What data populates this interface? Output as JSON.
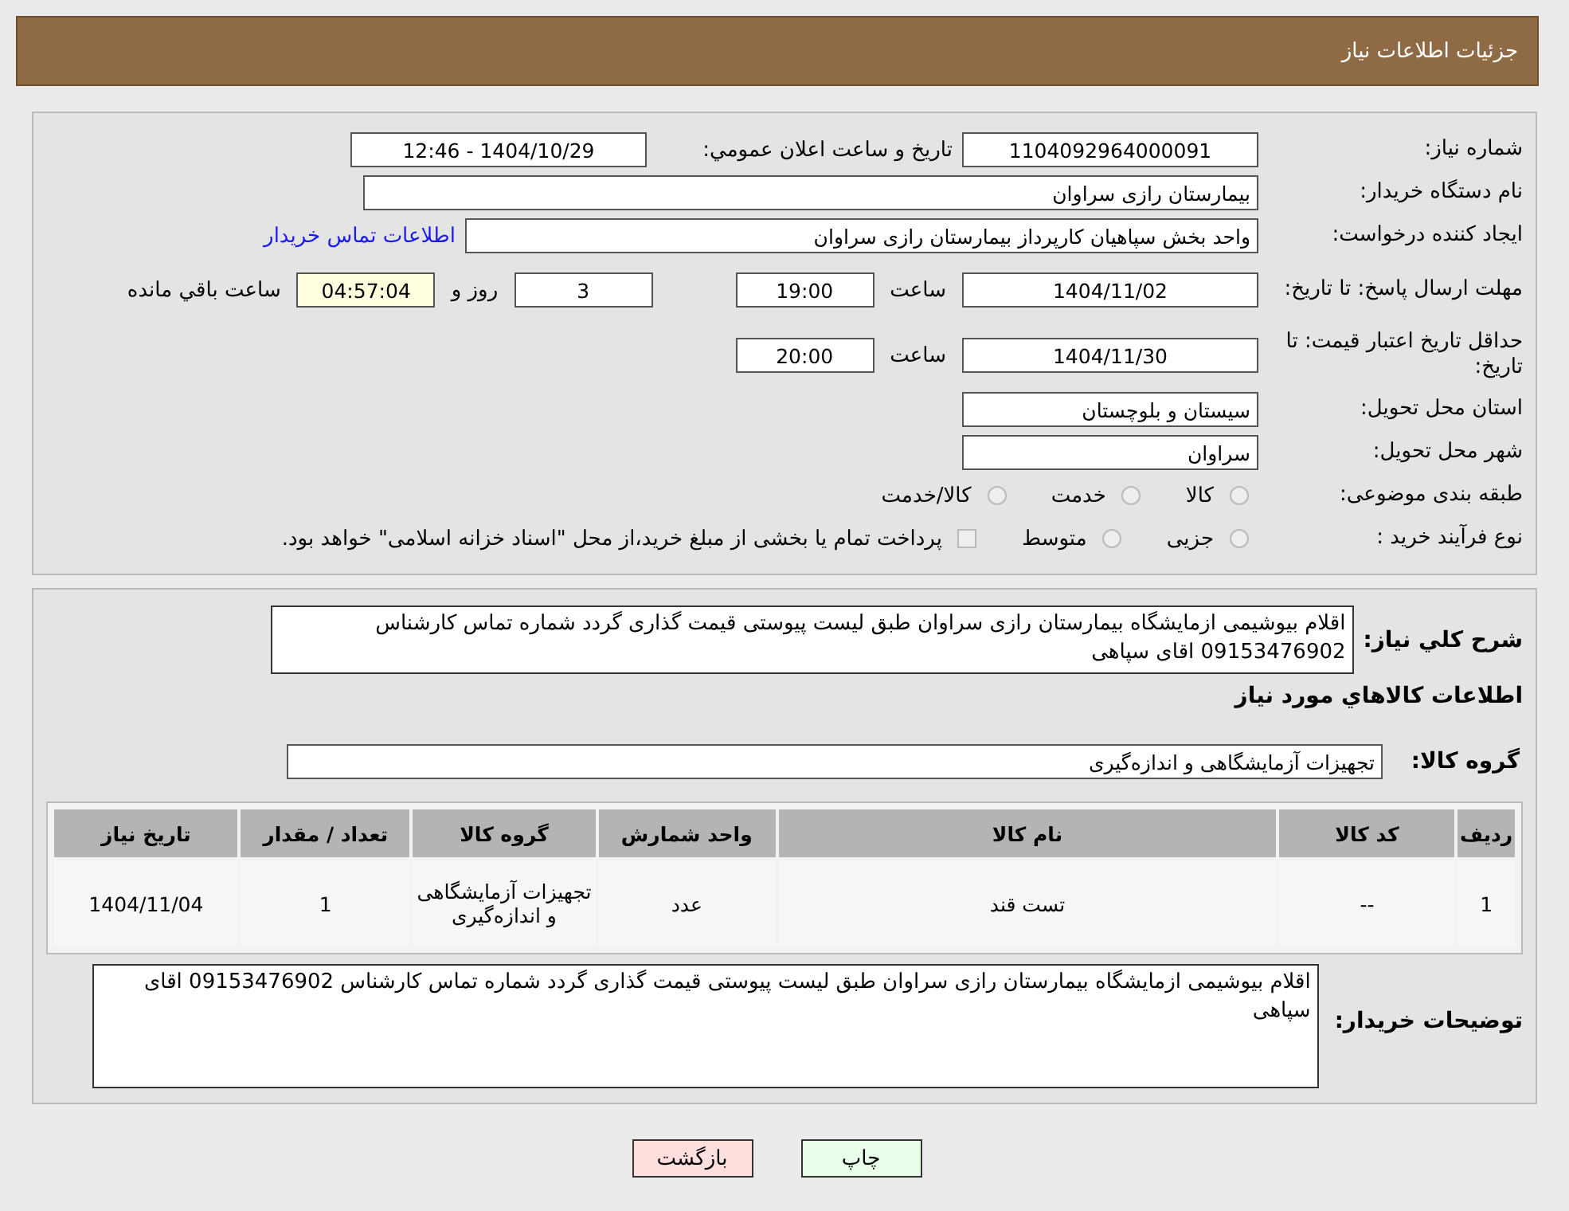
{
  "header": {
    "title": "جزئیات اطلاعات نیاز"
  },
  "need_number": {
    "label": "شماره نیاز:",
    "value": "1104092964000091"
  },
  "announce": {
    "label": "تاریخ و ساعت اعلان عمومي:",
    "value": "1404/10/29 - 12:46"
  },
  "buyer_org": {
    "label": "نام دستگاه خریدار:",
    "value": "بیمارستان رازی سراوان"
  },
  "requester": {
    "label": "ایجاد کننده درخواست:",
    "value": "واحد بخش  سپاهیان کارپرداز بیمارستان رازی سراوان",
    "link": "اطلاعات تماس خریدار"
  },
  "reply_deadline": {
    "label": "مهلت ارسال پاسخ: تا تاریخ:",
    "date": "1404/11/02",
    "time_label": "ساعت",
    "time": "19:00",
    "days": "3",
    "days_label": "روز و",
    "remaining": "04:57:04",
    "remaining_label": "ساعت باقي مانده"
  },
  "price_validity": {
    "label": "حداقل تاریخ اعتبار قیمت: تا تاریخ:",
    "date": "1404/11/30",
    "time_label": "ساعت",
    "time": "20:00"
  },
  "province": {
    "label": "استان محل تحویل:",
    "value": "سیستان و بلوچستان"
  },
  "city": {
    "label": "شهر محل تحویل:",
    "value": "سراوان"
  },
  "category": {
    "label": "طبقه بندی موضوعی:",
    "options": [
      {
        "label": "کالا",
        "selected": false
      },
      {
        "label": "خدمت",
        "selected": false
      },
      {
        "label": "کالا/خدمت",
        "selected": false
      }
    ]
  },
  "purchase_type": {
    "label": "نوع فرآیند خرید :",
    "options": [
      {
        "kind": "radio",
        "label": "جزیی",
        "selected": false
      },
      {
        "kind": "radio",
        "label": "متوسط",
        "selected": false
      },
      {
        "kind": "checkbox",
        "label": "پرداخت تمام یا بخشی از مبلغ خرید،از محل \"اسناد خزانه اسلامی\" خواهد بود.",
        "checked": false
      }
    ]
  },
  "description": {
    "label": "شرح کلي نیاز:",
    "value": "اقلام بیوشیمی ازمایشگاه بیمارستان رازی سراوان طبق لیست پیوستی قیمت گذاری گردد شماره تماس کارشناس 09153476902 اقای سپاهی"
  },
  "items_title": "اطلاعات کالاهاي مورد نیاز",
  "goods_group": {
    "label": "گروه کالا:",
    "value": "تجهیزات آزمایشگاهی و اندازه‌گیری"
  },
  "table": {
    "columns": [
      "ردیف",
      "کد کالا",
      "نام کالا",
      "واحد شمارش",
      "گروه کالا",
      "تعداد / مقدار",
      "تاریخ نیاز"
    ],
    "rows": [
      [
        "1",
        "--",
        "تست قند",
        "عدد",
        "تجهیزات آزمایشگاهی و اندازه‌گیری",
        "1",
        "1404/11/04"
      ]
    ]
  },
  "buyer_notes": {
    "label": "توضیحات خریدار:",
    "value": "اقلام بیوشیمی ازمایشگاه بیمارستان رازی سراوان طبق لیست پیوستی قیمت گذاری گردد شماره تماس کارشناس 09153476902 اقای سپاهی"
  },
  "buttons": [
    {
      "kind": "print",
      "label": "چاپ"
    },
    {
      "kind": "back",
      "label": "بازگشت"
    }
  ]
}
